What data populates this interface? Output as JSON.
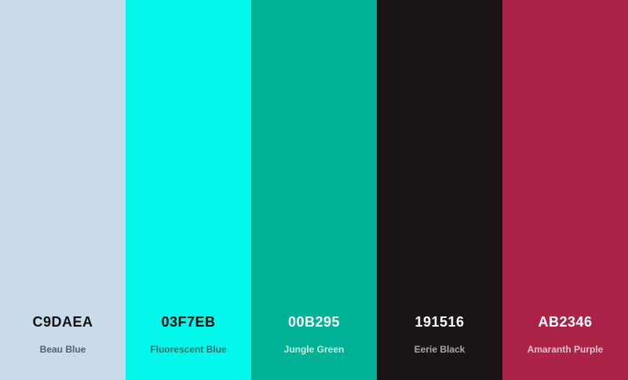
{
  "swatches": [
    {
      "hex": "C9DAEA",
      "name": "Beau Blue",
      "color": "#C9DAEA",
      "hex_text_color": "#111111",
      "name_text_color": "#555e66"
    },
    {
      "hex": "03F7EB",
      "name": "Fluorescent Blue",
      "color": "#03F7EB",
      "hex_text_color": "#111111",
      "name_text_color": "#2f6e6a"
    },
    {
      "hex": "00B295",
      "name": "Jungle Green",
      "color": "#00B295",
      "hex_text_color": "#ffffff",
      "name_text_color": "#c7efe6"
    },
    {
      "hex": "191516",
      "name": "Eerie Black",
      "color": "#191516",
      "hex_text_color": "#ffffff",
      "name_text_color": "#a9a6a7"
    },
    {
      "hex": "AB2346",
      "name": "Amaranth Purple",
      "color": "#AB2346",
      "hex_text_color": "#ffffff",
      "name_text_color": "#e6c2cb"
    }
  ]
}
